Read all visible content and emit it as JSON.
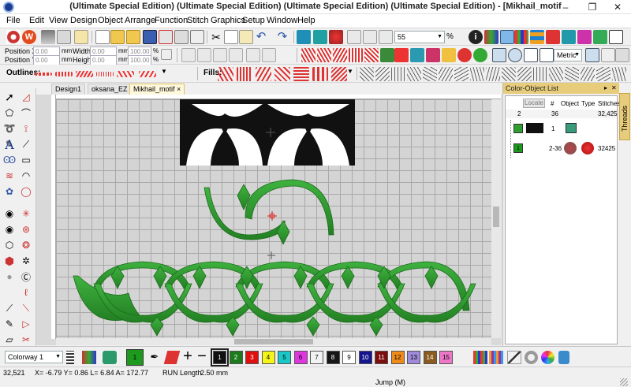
{
  "window": {
    "title": "(Ultimate Special Edition) (Ultimate Special Edition) (Ultimate Special Edition) (Ultimate Special Edition) - [Mikhail_motif",
    "minimize": "–",
    "maximize": "❐",
    "close": "✕"
  },
  "menu": [
    "File",
    "Edit",
    "View",
    "Design",
    "Object",
    "Arrange",
    "Function",
    "Stitch",
    "Graphics",
    "Setup",
    "Window",
    "Help"
  ],
  "toolbar": {
    "zoom_value": "55",
    "zoom_unit": "%",
    "units_value": "Metric"
  },
  "props": {
    "pos_x_label": "Position X:",
    "pos_y_label": "Position Y:",
    "pos_x": "0.00",
    "pos_y": "0.00",
    "pos_unit": "mm",
    "width_label": "Width:",
    "height_label": "Height:",
    "width": "0.00",
    "height": "0.00",
    "size_unit": "mm",
    "scale_w": "100.00",
    "scale_h": "100.00",
    "scale_unit": "%"
  },
  "outlines_label": "Outlines:",
  "fills_label": "Fills:",
  "tabs": [
    {
      "label": "Design1"
    },
    {
      "label": "oksana_EZ"
    },
    {
      "label": "Mikhail_motif"
    }
  ],
  "tab_close": "×",
  "panel": {
    "title": "Color-Object List",
    "close": "✕",
    "pin": "▸",
    "locate": "Locate",
    "columns": [
      "#",
      "Object",
      "Type",
      "Stitches"
    ],
    "summary": {
      "count": "2",
      "objects": "36",
      "stitches": "32,425"
    },
    "rows": [
      {
        "index": "1",
        "num": "1",
        "stitches": ""
      },
      {
        "index": "1",
        "num": "2-36",
        "stitches": "32425"
      }
    ],
    "threads_tab": "Threads"
  },
  "colorway": {
    "selected": "Colorway 1",
    "current_slot": "1",
    "swatches": [
      {
        "n": "1",
        "color": "#111111"
      },
      {
        "n": "2",
        "color": "#1d7a1d"
      },
      {
        "n": "3",
        "color": "#e01010"
      },
      {
        "n": "4",
        "color": "#f5f51a"
      },
      {
        "n": "5",
        "color": "#19c7c7"
      },
      {
        "n": "6",
        "color": "#e036e0"
      },
      {
        "n": "7",
        "color": "#f2f2f2"
      },
      {
        "n": "8",
        "color": "#161616"
      },
      {
        "n": "9",
        "color": "#ffffff"
      },
      {
        "n": "10",
        "color": "#14148c"
      },
      {
        "n": "11",
        "color": "#7d0e0e"
      },
      {
        "n": "12",
        "color": "#f08a1a"
      },
      {
        "n": "13",
        "color": "#9e8ad8"
      },
      {
        "n": "14",
        "color": "#8a5a1e"
      },
      {
        "n": "15",
        "color": "#ee77c8"
      }
    ]
  },
  "status": {
    "stitch_count": "32,521",
    "coords": "X=   -6.79 Y=   0.86 L=   6.84 A= 172.77",
    "run_length_label": "RUN Length",
    "run_length_value": "2.50 mm",
    "mode": "Jump (M)"
  },
  "colors": {
    "motif_green": "#2e9e2e",
    "title_gold": "#e7cd7b"
  }
}
